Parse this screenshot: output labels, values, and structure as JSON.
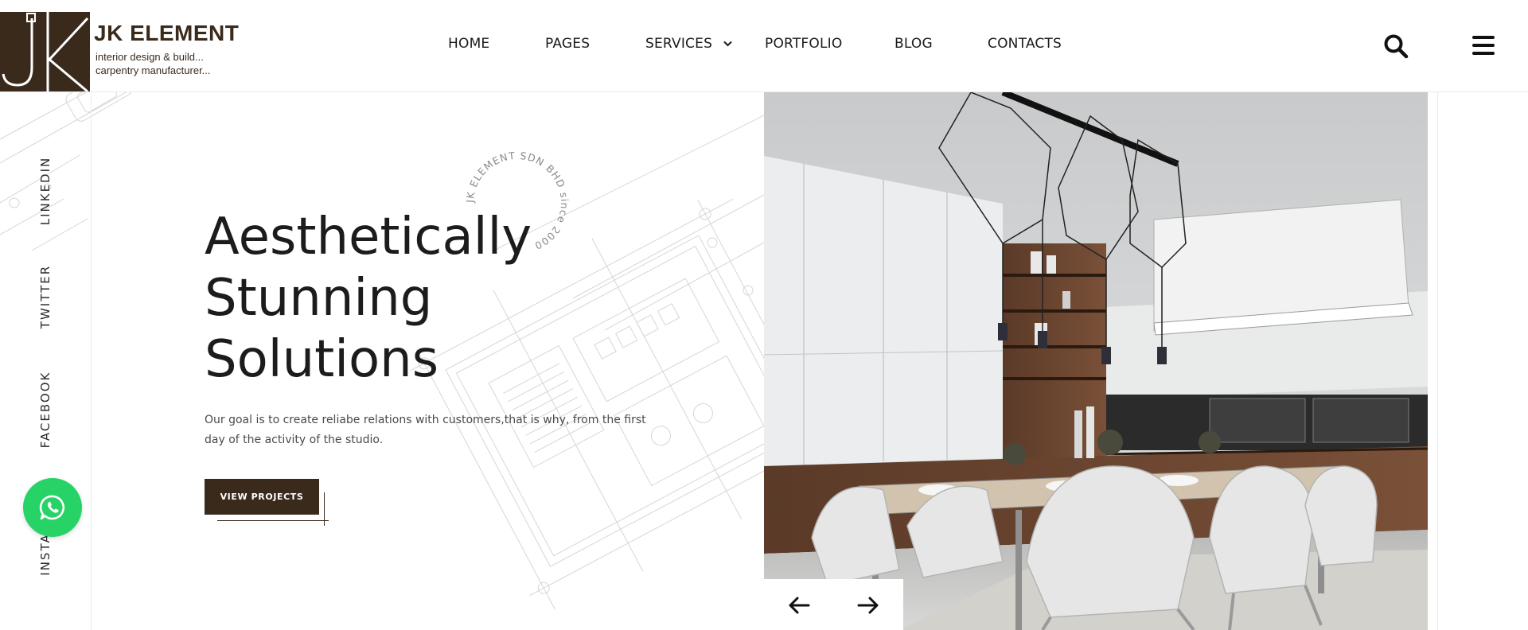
{
  "brand": {
    "name": "JK ELEMENT",
    "tagline_line1": "interior design & build...",
    "tagline_line2": "carpentry manufacturer...",
    "logo_letters": "JK",
    "color": "#3a2a1c"
  },
  "nav": {
    "items": [
      {
        "label": "HOME"
      },
      {
        "label": "PAGES"
      },
      {
        "label": "SERVICES",
        "has_dropdown": true
      },
      {
        "label": "PORTFOLIO"
      },
      {
        "label": "BLOG"
      },
      {
        "label": "CONTACTS"
      }
    ]
  },
  "header_icons": {
    "search": "search-icon",
    "menu": "hamburger-menu-icon"
  },
  "social": {
    "items": [
      {
        "label": "LINKEDIN"
      },
      {
        "label": "TWITTER"
      },
      {
        "label": "FACEBOOK"
      },
      {
        "label": "INSTA"
      }
    ]
  },
  "whatsapp": {
    "icon": "whatsapp-icon",
    "color": "#27d366"
  },
  "seal": {
    "text": "JK ELEMENT SDN BHD since 2000"
  },
  "hero": {
    "title_line1": "Aesthetically",
    "title_line2": "Stunning",
    "title_line3": "Solutions",
    "desc_line1": "Our goal is to create reliabe relations with customers,that is why, from the first",
    "desc_line2": "day of the activity of the studio.",
    "cta_label": "VIEW PROJECTS",
    "cta_color": "#3a2a1c"
  },
  "slider": {
    "prev_icon": "arrow-left-icon",
    "next_icon": "arrow-right-icon"
  }
}
